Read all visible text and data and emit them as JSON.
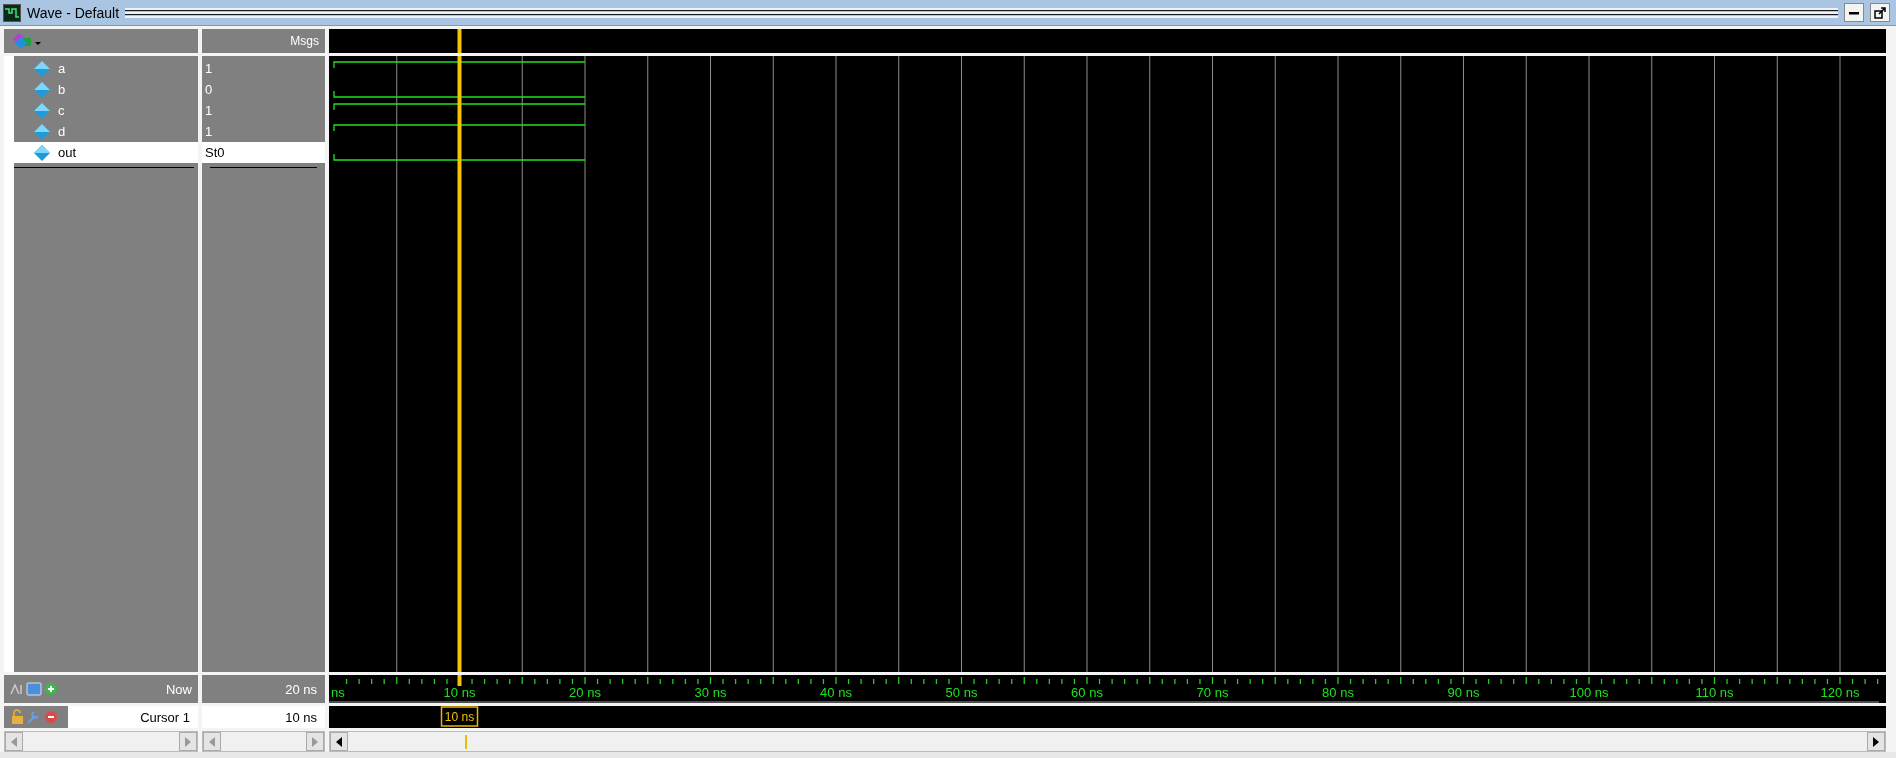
{
  "window": {
    "title": "Wave - Default"
  },
  "header": {
    "msgs": "Msgs"
  },
  "signals": [
    {
      "name": "a",
      "value": "1",
      "high": true,
      "selected": false
    },
    {
      "name": "b",
      "value": "0",
      "high": false,
      "selected": false
    },
    {
      "name": "c",
      "value": "1",
      "high": true,
      "selected": false
    },
    {
      "name": "d",
      "value": "1",
      "high": true,
      "selected": false
    },
    {
      "name": "out",
      "value": "St0",
      "high": false,
      "selected": true
    }
  ],
  "now": {
    "label": "Now",
    "value": "20 ns"
  },
  "cursor": {
    "label": "Cursor 1",
    "value": "10 ns",
    "marker": "10 ns"
  },
  "timeline": {
    "ticks": [
      "ns",
      "10 ns",
      "20 ns",
      "30 ns",
      "40 ns",
      "50 ns",
      "60 ns",
      "70 ns",
      "80 ns",
      "90 ns",
      "100 ns",
      "110 ns",
      "120 ns"
    ]
  }
}
